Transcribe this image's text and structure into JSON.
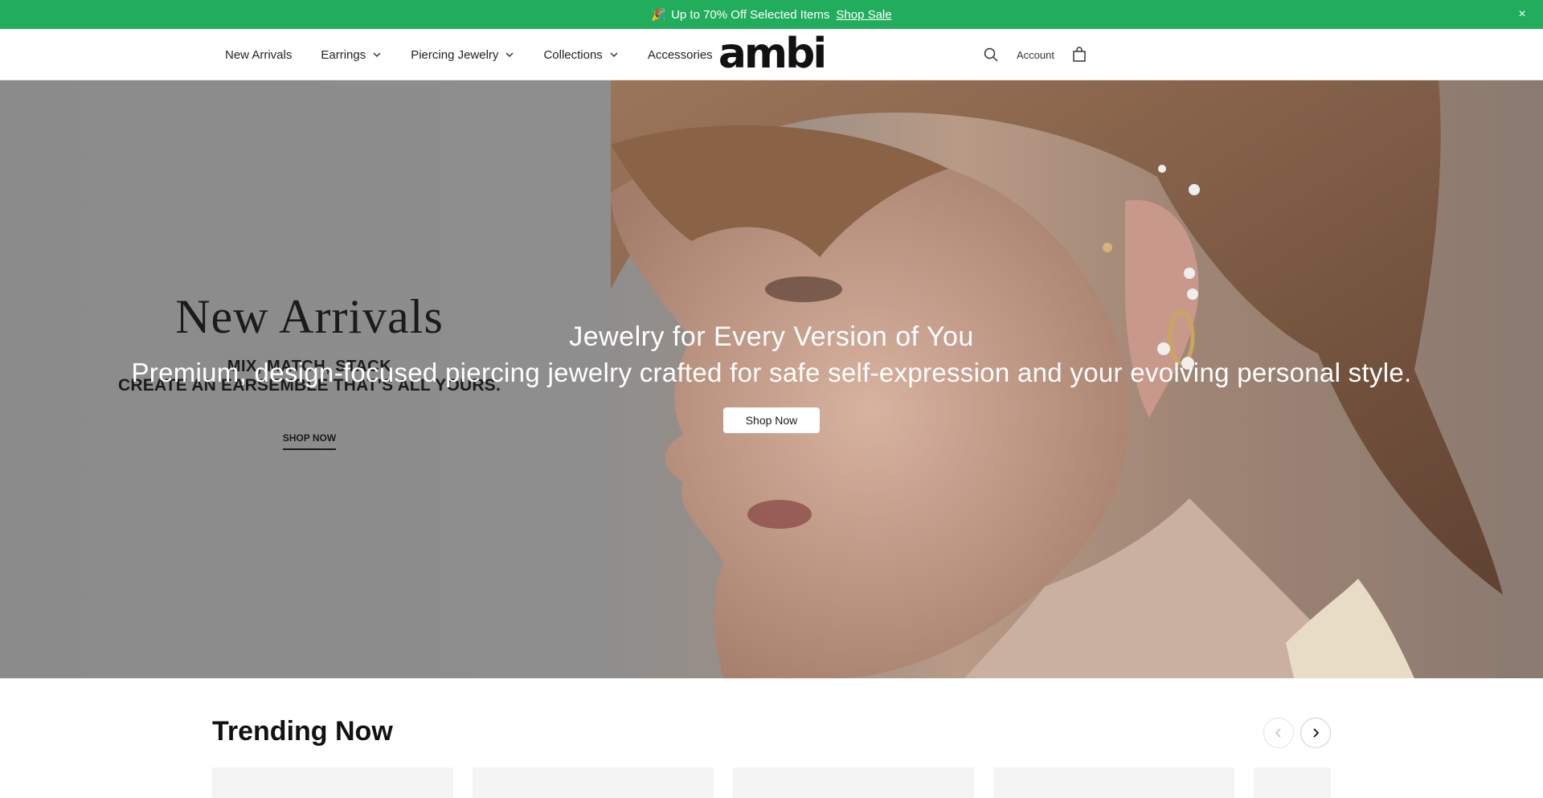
{
  "announcement": {
    "emoji": "🎉",
    "text": "Up to 70% Off Selected Items",
    "link": "Shop Sale",
    "close": "×"
  },
  "nav": {
    "items": [
      {
        "label": "New Arrivals"
      },
      {
        "label": "Earrings"
      },
      {
        "label": "Piercing Jewelry"
      },
      {
        "label": "Collections"
      },
      {
        "label": "Accessories"
      }
    ],
    "logo": "ambi",
    "account": "Account"
  },
  "hero": {
    "left_title": "New Arrivals",
    "left_subtitle1": "MIX, MATCH, STACK",
    "left_subtitle2": "CREATE AN EARSEMBLE THAT'S ALL YOURS.",
    "left_cta": "SHOP NOW",
    "center_title": "Jewelry for Every Version of You",
    "center_subtitle": "Premium, design-focused piercing jewelry crafted for safe self-expression and your evolving personal style.",
    "center_cta": "Shop Now"
  },
  "trending": {
    "title": "Trending Now"
  },
  "colors": {
    "announcement_bg": "#22ad5c",
    "text": "#1a1a1a",
    "button_bg": "#ffffff"
  }
}
